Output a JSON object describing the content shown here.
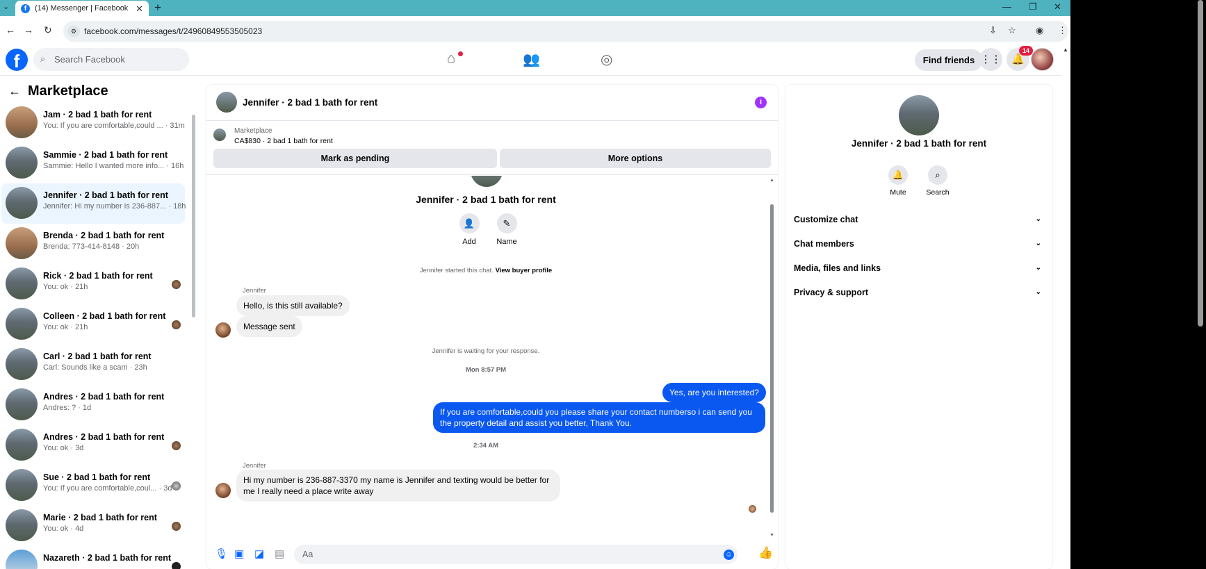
{
  "browser": {
    "tab_title": "(14) Messenger | Facebook",
    "url": "facebook.com/messages/t/24960849553505023"
  },
  "header": {
    "search_placeholder": "Search Facebook",
    "find_friends": "Find friends",
    "notifications_count": "14"
  },
  "sidebar": {
    "title": "Marketplace",
    "conversations": [
      {
        "name": "Jam · 2 bad 1 bath for rent",
        "preview": "You: If you are comfortable,could ... · 31m"
      },
      {
        "name": "Sammie · 2 bad 1 bath for rent",
        "preview": "Sammie: Hello I wanted more info... · 16h"
      },
      {
        "name": "Jennifer · 2 bad 1 bath for rent",
        "preview": "Jennifer: Hi my number is 236-887... · 18h"
      },
      {
        "name": "Brenda · 2 bad 1 bath for rent",
        "preview": "Brenda: 773-414-8148 · 20h"
      },
      {
        "name": "Rick · 2 bad 1 bath for rent",
        "preview": "You: ok · 21h"
      },
      {
        "name": "Colleen · 2 bad 1 bath for rent",
        "preview": "You: ok · 21h"
      },
      {
        "name": "Carl · 2 bad 1 bath for rent",
        "preview": "Carl: Sounds like a scam · 23h"
      },
      {
        "name": "Andres · 2 bad 1 bath for rent",
        "preview": "Andres: ? · 1d"
      },
      {
        "name": "Andres · 2 bad 1 bath for rent",
        "preview": "You: ok · 3d"
      },
      {
        "name": "Sue · 2 bad 1 bath for rent",
        "preview": "You: If you are comfortable,coul... · 3d"
      },
      {
        "name": "Marie · 2 bad 1 bath for rent",
        "preview": "You: ok · 4d"
      },
      {
        "name": "Nazareth · 2 bad 1 bath for rent",
        "preview": ""
      }
    ]
  },
  "chat": {
    "title": "Jennifer · 2 bad 1 bath for rent",
    "listing_source": "Marketplace",
    "listing_price": "CA$830 · 2 bad 1 bath for rent",
    "mark_pending": "Mark as pending",
    "more_options": "More options",
    "intro_name": "Jennifer · 2 bad 1 bath for rent",
    "add_label": "Add",
    "name_label": "Name",
    "started_text": "Jennifer started this chat.",
    "view_profile": "View buyer profile",
    "sender1": "Jennifer",
    "msg1": "Hello, is this still available?",
    "msg2": "Message sent",
    "waiting": "Jennifer is waiting for your response.",
    "time1": "Mon 8:57 PM",
    "out1": "Yes, are you interested?",
    "out2": "If you are comfortable,could you please share your contact numberso i can send you the property detail and assist you better, Thank You.",
    "time2": "2:34 AM",
    "sender2": "Jennifer",
    "msg3": "Hi my number is 236-887-3370 my name is Jennifer and texting would be better for me I really need a place write away",
    "composer_placeholder": "Aa"
  },
  "info": {
    "title": "Jennifer · 2 bad 1 bath for rent",
    "mute": "Mute",
    "search": "Search",
    "sections": [
      "Customize chat",
      "Chat members",
      "Media, files and links",
      "Privacy & support"
    ]
  }
}
